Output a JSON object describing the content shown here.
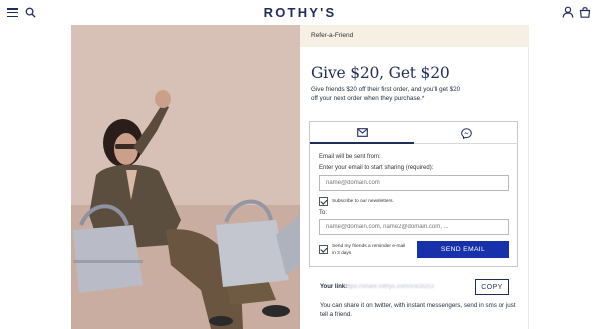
{
  "header": {
    "logo": "ROTHY'S",
    "icons": [
      "menu-icon",
      "search-icon",
      "user-icon",
      "bag-icon"
    ]
  },
  "breadcrumb": "Refer-a-Friend",
  "offer": {
    "title": "Give $20, Get $20",
    "description": "Give friends $20 off their first order, and you'll get $20 off your next order when they purchase.*"
  },
  "share_tabs": [
    {
      "icon": "email-icon",
      "active": true
    },
    {
      "icon": "messenger-icon",
      "active": false
    }
  ],
  "form": {
    "sent_from_label": "Email will be sent from:",
    "enter_email_label": "Enter your email to start sharing (required):",
    "email_placeholder": "name@domain.com",
    "subscribe_label": "Subscribe to our newsletters.",
    "subscribe_checked": true,
    "to_label": "To:",
    "to_placeholder": "name@domain.com, name2@domain.com, ...",
    "reminder_label": "Send my friends a reminder e-mail in 3 days",
    "reminder_checked": true,
    "send_button": "SEND EMAIL"
  },
  "link_section": {
    "label": "Your link:",
    "url": "https://share.rothys.com/x/a1b2c3",
    "copy_button": "COPY",
    "note": "You can share it on twitter, with instant messengers, send in sms or just tell a friend."
  },
  "colors": {
    "brand_navy": "#1f2d5a",
    "button_blue": "#1631a9",
    "banner_beige": "#f5efe4"
  }
}
